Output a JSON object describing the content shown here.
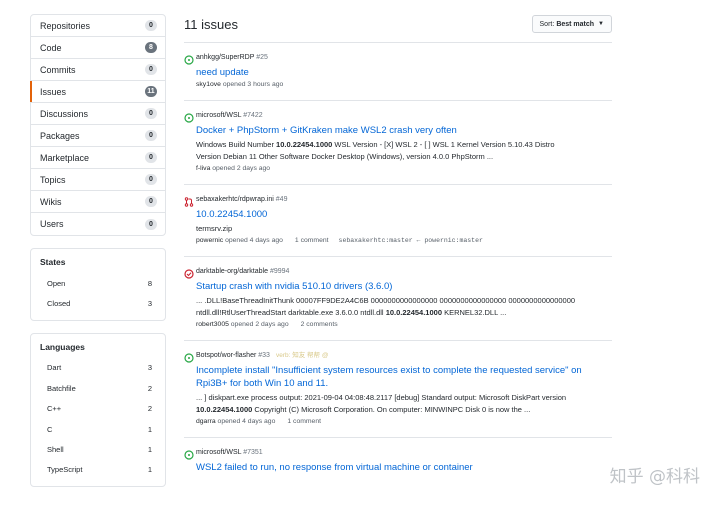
{
  "sidebar": {
    "menu": [
      {
        "label": "Repositories",
        "count": "0"
      },
      {
        "label": "Code",
        "count": "8"
      },
      {
        "label": "Commits",
        "count": "0"
      },
      {
        "label": "Issues",
        "count": "11"
      },
      {
        "label": "Discussions",
        "count": "0"
      },
      {
        "label": "Packages",
        "count": "0"
      },
      {
        "label": "Marketplace",
        "count": "0"
      },
      {
        "label": "Topics",
        "count": "0"
      },
      {
        "label": "Wikis",
        "count": "0"
      },
      {
        "label": "Users",
        "count": "0"
      }
    ],
    "states": {
      "title": "States",
      "items": [
        {
          "label": "Open",
          "count": "8"
        },
        {
          "label": "Closed",
          "count": "3"
        }
      ]
    },
    "languages": {
      "title": "Languages",
      "items": [
        {
          "label": "Dart",
          "count": "3"
        },
        {
          "label": "Batchfile",
          "count": "2"
        },
        {
          "label": "C++",
          "count": "2"
        },
        {
          "label": "C",
          "count": "1"
        },
        {
          "label": "Shell",
          "count": "1"
        },
        {
          "label": "TypeScript",
          "count": "1"
        }
      ]
    }
  },
  "header": {
    "title": "11 issues",
    "sort_prefix": "Sort:",
    "sort_value": "Best match"
  },
  "issues": [
    {
      "repo": "anhkgg/SuperRDP",
      "number": "#25",
      "title": "need update",
      "author": "sky1ove",
      "time": "opened 3 hours ago"
    },
    {
      "repo": "microsoft/WSL",
      "number": "#7422",
      "title": "Docker + PhpStorm + GitKraken make WSL2 crash very often",
      "snippet1_a": "Windows Build Number ",
      "snippet1_b": "10.0.22454.1000",
      "snippet1_c": " WSL Version - [X] WSL 2 - [ ] WSL 1 Kernel Version 5.10.43 Distro",
      "snippet2": "Version Debian 11 Other Software Docker Desktop (Windows), version 4.0.0 PhpStorm ...",
      "author": "f-liva",
      "time": "opened 2 days ago"
    },
    {
      "repo": "sebaxakerhtc/rdpwrap.ini",
      "number": "#49",
      "title": "10.0.22454.1000",
      "snippet1": "termsrv.zip",
      "author": "powernic",
      "time": "opened 4 days ago",
      "comments": "1 comment",
      "branch": "sebaxakerhtc:master ← powernic:master"
    },
    {
      "repo": "darktable-org/darktable",
      "number": "#9994",
      "title": "Startup crash with nvidia 510.10 drivers (3.6.0)",
      "snippet1": "... .DLL!BaseThreadInitThunk 00007FF9DE2A4C6B 0000000000000000 0000000000000000 0000000000000000",
      "snippet2_a": "ntdll.dll!RtlUserThreadStart darktable.exe 3.6.0.0 ntdll.dll ",
      "snippet2_b": "10.0.22454.1000",
      "snippet2_c": " KERNEL32.DLL ...",
      "author": "robert3005",
      "time": "opened 2 days ago",
      "comments": "2 comments"
    },
    {
      "repo": "Botspot/wor-flasher",
      "number": "#33",
      "ghost": "verb: 知友 帮帮 @",
      "title1": "Incomplete install \"Insufficient system resources exist to complete the requested service\" on",
      "title2": "Rpi3B+ for both Win 10 and 11.",
      "snippet1": "... ] diskpart.exe process output: 2021-09-04 04:08:48.2117 [debug] Standard output: Microsoft DiskPart version",
      "snippet2_a": "10.0.22454.1000",
      "snippet2_b": " Copyright (C) Microsoft Corporation. On computer: MINWINPC Disk 0 is now the ...",
      "author": "dgarra",
      "time": "opened 4 days ago",
      "comments": "1 comment"
    },
    {
      "repo": "microsoft/WSL",
      "number": "#7351",
      "title": "WSL2 failed to run, no response from virtual machine or container"
    }
  ],
  "watermark": "知乎 @科科",
  "colors": {
    "open": "#28a745",
    "closed": "#cb2431",
    "merged": "#cb2431",
    "link": "#0366d6",
    "accent": "#e36209"
  }
}
